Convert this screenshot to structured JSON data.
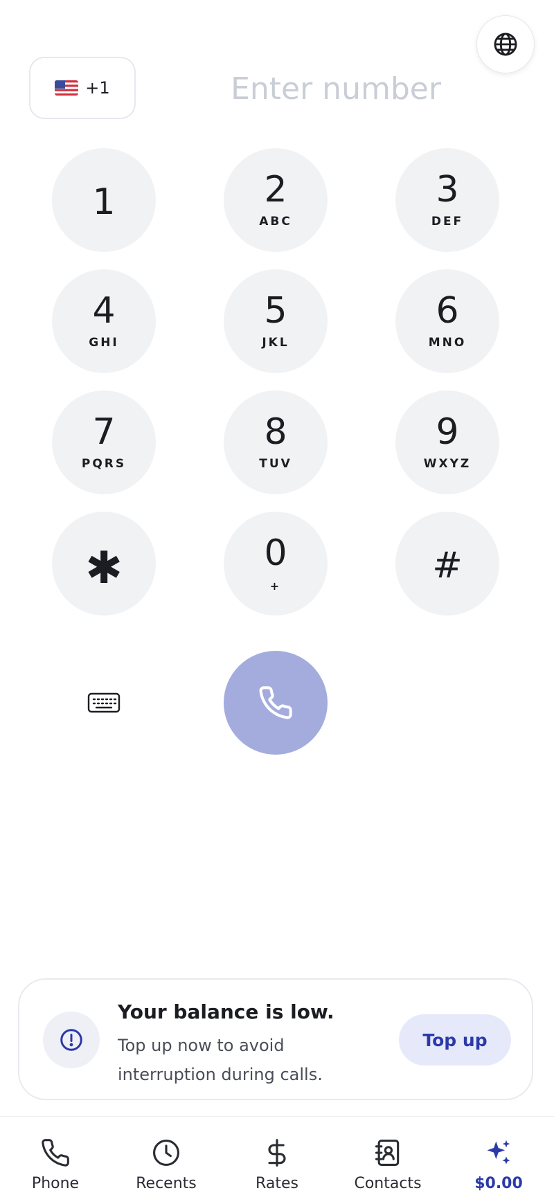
{
  "header": {
    "country_code": "+1",
    "number_placeholder": "Enter number",
    "number_value": ""
  },
  "keypad": [
    {
      "digit": "1",
      "letters": ""
    },
    {
      "digit": "2",
      "letters": "ABC"
    },
    {
      "digit": "3",
      "letters": "DEF"
    },
    {
      "digit": "4",
      "letters": "GHI"
    },
    {
      "digit": "5",
      "letters": "JKL"
    },
    {
      "digit": "6",
      "letters": "MNO"
    },
    {
      "digit": "7",
      "letters": "PQRS"
    },
    {
      "digit": "8",
      "letters": "TUV"
    },
    {
      "digit": "9",
      "letters": "WXYZ"
    },
    {
      "digit": "✱",
      "letters": ""
    },
    {
      "digit": "0",
      "letters": "+"
    },
    {
      "digit": "#",
      "letters": ""
    }
  ],
  "balance_alert": {
    "title": "Your balance is low.",
    "message": "Top up now to avoid interruption during calls.",
    "button_label": "Top up"
  },
  "tabs": [
    {
      "label": "Phone",
      "icon": "phone-icon"
    },
    {
      "label": "Recents",
      "icon": "clock-icon"
    },
    {
      "label": "Rates",
      "icon": "dollar-icon"
    },
    {
      "label": "Contacts",
      "icon": "contacts-book-icon"
    },
    {
      "label": "$0.00",
      "icon": "sparkles-icon",
      "active": true
    }
  ],
  "colors": {
    "accent": "#2b3aa8",
    "call_button": "#a3acdc",
    "key_background": "#f1f2f4",
    "placeholder": "#c9cdd6"
  }
}
